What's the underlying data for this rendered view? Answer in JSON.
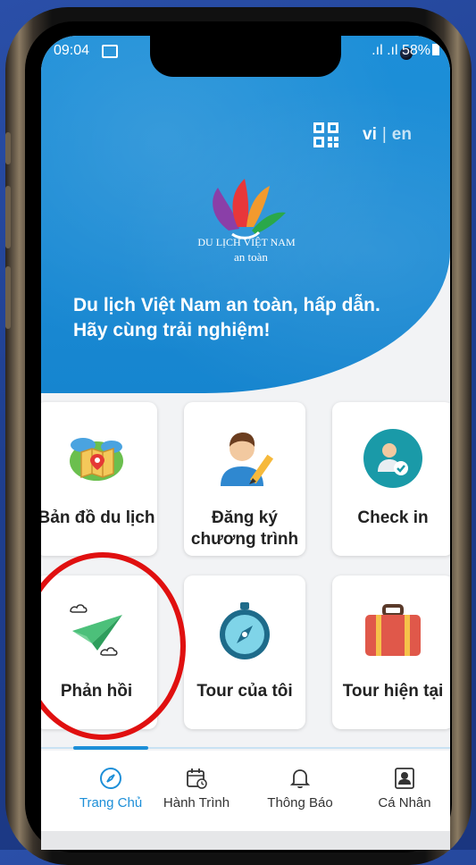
{
  "status_bar": {
    "time": "09:04",
    "signal": ".ıl .ıl",
    "battery": "58%"
  },
  "header": {
    "lang_vi": "vi",
    "lang_en": "en",
    "lang_sep": "|"
  },
  "logo": {
    "title": "DU LỊCH VIỆT NAM",
    "subtitle": "an toàn"
  },
  "hero": {
    "line1": "Du lịch Việt Nam an toàn, hấp dẫn.",
    "line2": "Hãy cùng trải nghiệm!"
  },
  "features": [
    {
      "label": "Bản đồ du lịch",
      "icon": "map-icon"
    },
    {
      "label": "Đăng ký chương trình",
      "icon": "register-icon"
    },
    {
      "label": "Check in",
      "icon": "check-in-icon"
    },
    {
      "label": "Phản hồi",
      "icon": "paper-plane-icon"
    },
    {
      "label": "Tour của tôi",
      "icon": "compass-icon"
    },
    {
      "label": "Tour hiện tại",
      "icon": "suitcase-icon"
    }
  ],
  "nav": [
    {
      "label": "Trang Chủ",
      "icon": "compass-nav-icon",
      "active": true
    },
    {
      "label": "Hành Trình",
      "icon": "calendar-icon",
      "active": false
    },
    {
      "label": "Thông Báo",
      "icon": "bell-icon",
      "active": false
    },
    {
      "label": "Cá Nhân",
      "icon": "profile-icon",
      "active": false
    }
  ],
  "colors": {
    "primary": "#1d8fd8",
    "highlight": "#e01010",
    "background": "#2a4fa8"
  }
}
